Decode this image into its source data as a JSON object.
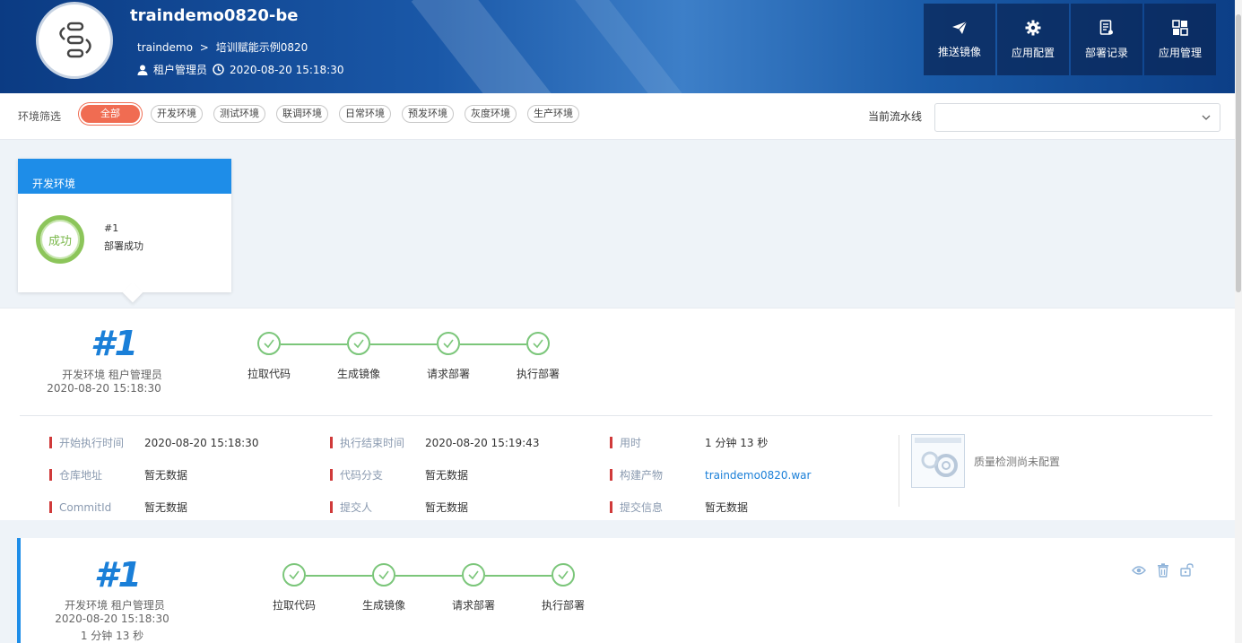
{
  "header": {
    "app_name": "traindemo0820-be",
    "breadcrumb": {
      "tenant": "traindemo",
      "sep": ">",
      "project": "培训赋能示例0820"
    },
    "role": "租户管理员",
    "time": "2020-08-20 15:18:30",
    "actions": [
      {
        "label": "推送镜像",
        "icon": "send-icon"
      },
      {
        "label": "应用配置",
        "icon": "gear-icon"
      },
      {
        "label": "部署记录",
        "icon": "document-icon"
      },
      {
        "label": "应用管理",
        "icon": "grid-icon"
      }
    ]
  },
  "filter": {
    "label": "环境筛选",
    "chips": [
      "全部",
      "开发环境",
      "测试环境",
      "联调环境",
      "日常环境",
      "预发环境",
      "灰度环境",
      "生产环境"
    ],
    "active_index": 0,
    "pipeline_label": "当前流水线",
    "pipeline_value": ""
  },
  "env_card": {
    "title": "开发环境",
    "status_text": "成功",
    "run_no": "#1",
    "run_status": "部署成功"
  },
  "detail": {
    "run_no": "#1",
    "env_role": "开发环境 租户管理员",
    "time": "2020-08-20 15:18:30",
    "steps": [
      "拉取代码",
      "生成镜像",
      "请求部署",
      "执行部署"
    ],
    "info": [
      {
        "key": "开始执行时间",
        "value": "2020-08-20 15:18:30"
      },
      {
        "key": "执行结束时间",
        "value": "2020-08-20 15:19:43"
      },
      {
        "key": "用时",
        "value": "1 分钟 13 秒"
      },
      {
        "key": "仓库地址",
        "value": "暂无数据"
      },
      {
        "key": "代码分支",
        "value": "暂无数据"
      },
      {
        "key": "构建产物",
        "value": "traindemo0820.war"
      },
      {
        "key": "CommitId",
        "value": "暂无数据"
      },
      {
        "key": "提交人",
        "value": "暂无数据"
      },
      {
        "key": "提交信息",
        "value": "暂无数据"
      }
    ],
    "quality_text": "质量检测尚未配置"
  },
  "history": {
    "run_no": "#1",
    "env_role": "开发环境 租户管理员",
    "time": "2020-08-20 15:18:30",
    "duration": "1 分钟 13 秒",
    "steps": [
      "拉取代码",
      "生成镜像",
      "请求部署",
      "执行部署"
    ],
    "actions": [
      "eye-icon",
      "trash-icon",
      "unlock-icon"
    ]
  },
  "colors": {
    "accent": "#1e8de8",
    "success": "#7bc67a",
    "active_chip": "#f06c52",
    "marker": "#d03a3a"
  }
}
